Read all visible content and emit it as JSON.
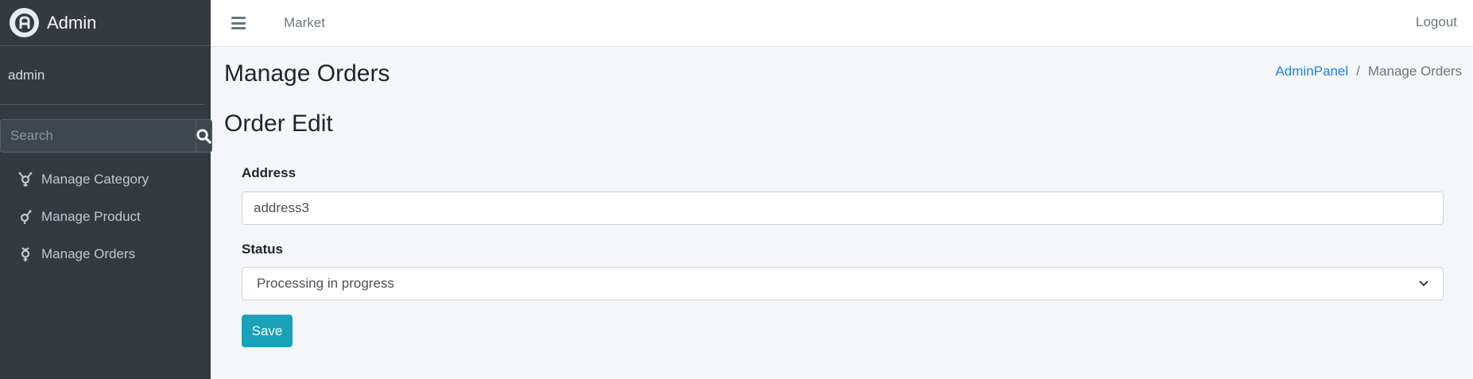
{
  "brand": {
    "name": "Admin",
    "logo_icon": "admin-logo-icon"
  },
  "user": {
    "name": "admin"
  },
  "sidebar_search": {
    "placeholder": "Search",
    "icon": "search-icon"
  },
  "sidebar": {
    "items": [
      {
        "label": "Manage Category",
        "icon": "transgender-symbol-icon"
      },
      {
        "label": "Manage Product",
        "icon": "genderless-symbol-icon"
      },
      {
        "label": "Manage Orders",
        "icon": "mercury-symbol-icon"
      }
    ]
  },
  "topbar": {
    "menu_icon": "hamburger-icon",
    "link": "Market",
    "logout": "Logout"
  },
  "page": {
    "title": "Manage Orders"
  },
  "breadcrumb": {
    "root": "AdminPanel",
    "separator": "/",
    "current": "Manage Orders"
  },
  "form": {
    "title": "Order Edit",
    "address_label": "Address",
    "address_value": "address3",
    "status_label": "Status",
    "status_value": "Processing in progress",
    "save_label": "Save"
  },
  "colors": {
    "sidebar_bg": "#343a40",
    "accent": "#17a2b8",
    "link": "#1f7fe6",
    "content_bg": "#f4f6f9"
  }
}
